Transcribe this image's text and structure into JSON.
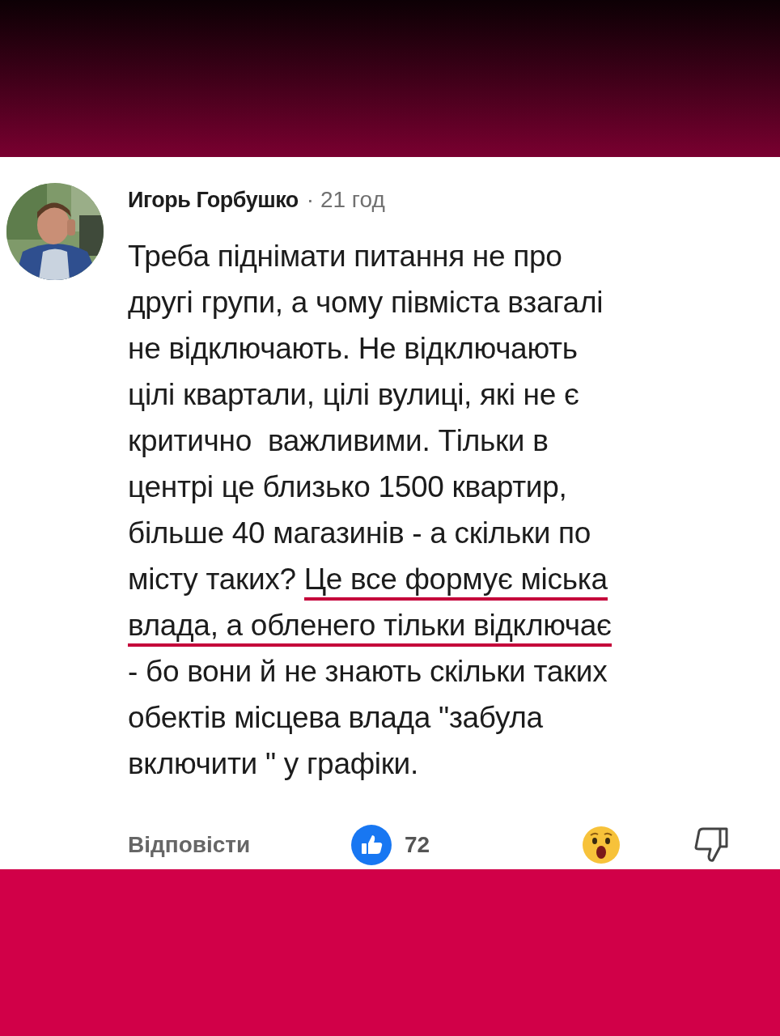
{
  "comment": {
    "author": "Игорь Горбушко",
    "time": "· 21 год",
    "lines": [
      [
        {
          "text": "Треба піднімати питання не про",
          "underlined": false
        }
      ],
      [
        {
          "text": "другі групи, а чому півміста взагалі",
          "underlined": false
        }
      ],
      [
        {
          "text": "не відключають. Не відключають",
          "underlined": false
        }
      ],
      [
        {
          "text": "цілі квартали, цілі вулиці, які не є",
          "underlined": false
        }
      ],
      [
        {
          "text": "критично  важливими. Тільки в",
          "underlined": false
        }
      ],
      [
        {
          "text": "центрі це близько 1500 квартир,",
          "underlined": false
        }
      ],
      [
        {
          "text": "більше 40 магазинів - а скільки по",
          "underlined": false
        }
      ],
      [
        {
          "text": "місту таких? ",
          "underlined": false
        },
        {
          "text": "Це все формує міська",
          "underlined": true
        }
      ],
      [
        {
          "text": "влада, а обленего тільки відключає",
          "underlined": true
        }
      ],
      [
        {
          "text": "- бо вони й не знають скільки таких",
          "underlined": false
        }
      ],
      [
        {
          "text": "обектів місцева влада \"забула",
          "underlined": false
        }
      ],
      [
        {
          "text": "включити \" у графіки.",
          "underlined": false
        }
      ]
    ],
    "reply": "Відповісти",
    "likes": "72"
  }
}
